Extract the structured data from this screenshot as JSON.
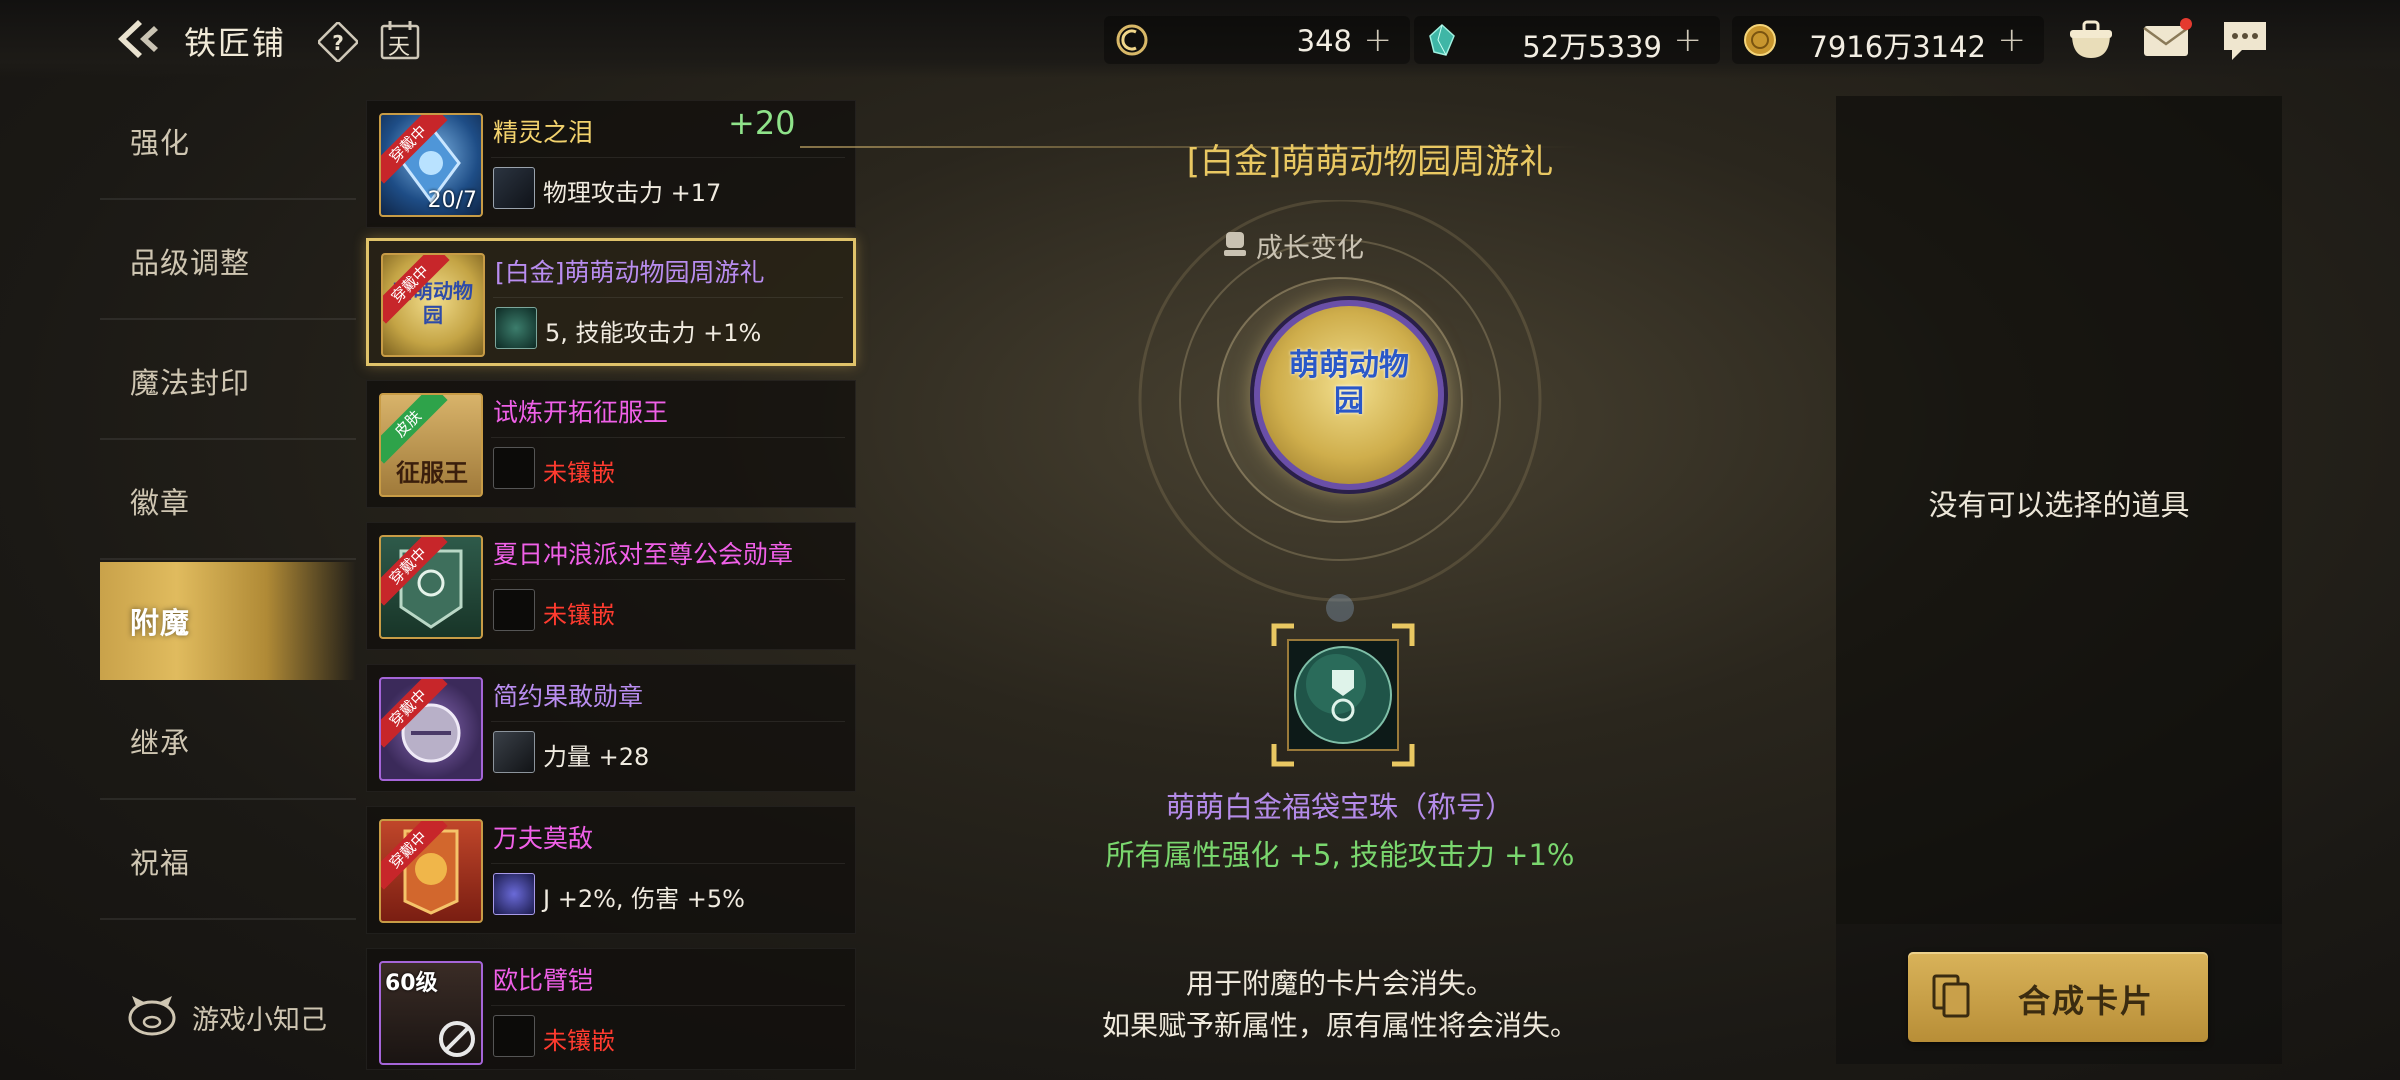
{
  "header": {
    "title": "铁匠铺",
    "calendar_glyph": "天",
    "currencies": [
      {
        "icon": "crest-coin-icon",
        "value": "348"
      },
      {
        "icon": "teal-gem-icon",
        "value": "52万5339"
      },
      {
        "icon": "gold-coin-icon",
        "value": "7916万3142"
      }
    ],
    "plus": "+"
  },
  "tabs": [
    "强化",
    "品级调整",
    "魔法封印",
    "徽章",
    "附魔",
    "继承",
    "祝福"
  ],
  "active_tab": "附魔",
  "tips_label": "游戏小知己",
  "items": [
    {
      "name": "精灵之泪",
      "color": "#f3d36e",
      "attr": "物理攻击力 +17",
      "badge": "穿戴中",
      "level": "",
      "thumb_text": "20/7",
      "selected": false,
      "empty": false
    },
    {
      "name": "[白金]萌萌动物园周游礼",
      "color": "#b98df0",
      "attr": "5, 技能攻击力 +1%",
      "badge": "穿戴中",
      "level": "",
      "thumb_text": "萌萌动物园",
      "selected": true,
      "empty": false
    },
    {
      "name": "试炼开拓征服王",
      "color": "#f060e8",
      "attr": "未镶嵌",
      "badge": "皮肤",
      "level": "",
      "thumb_text": "征服王",
      "selected": false,
      "empty": true
    },
    {
      "name": "夏日冲浪派对至尊公会勋章",
      "color": "#f060e8",
      "attr": "未镶嵌",
      "badge": "穿戴中",
      "level": "",
      "thumb_text": "",
      "selected": false,
      "empty": true
    },
    {
      "name": "简约果敢勋章",
      "color": "#b98df0",
      "attr": "力量 +28",
      "badge": "穿戴中",
      "level": "",
      "thumb_text": "",
      "selected": false,
      "empty": false
    },
    {
      "name": "万夫莫敌",
      "color": "#f060e8",
      "attr": "J +2%, 伤害 +5%",
      "badge": "穿戴中",
      "level": "",
      "thumb_text": "",
      "selected": false,
      "empty": false
    },
    {
      "name": "欧比臂铠",
      "color": "#f060e8",
      "attr": "未镶嵌",
      "badge": "",
      "level": "60级",
      "thumb_text": "",
      "selected": false,
      "empty": true
    }
  ],
  "floating_plus": "+20",
  "detail": {
    "title": "[白金]萌萌动物园周游礼",
    "growth_label": "成长变化",
    "medallion_text": "萌萌动物园",
    "effect_name": "萌萌白金福袋宝珠（称号）",
    "effect_value": "所有属性强化 +5, 技能攻击力 +1%",
    "note1": "用于附魔的卡片会消失。",
    "note2": "如果赋予新属性，原有属性将会消失。"
  },
  "right_panel": {
    "empty_text": "没有可以选择的道具",
    "synth_button": "合成卡片"
  },
  "colors": {
    "gold_accent": "#e0c36a",
    "green_value": "#7ad76e",
    "purple_name": "#b48be8",
    "red_empty": "#ff3b2f"
  }
}
